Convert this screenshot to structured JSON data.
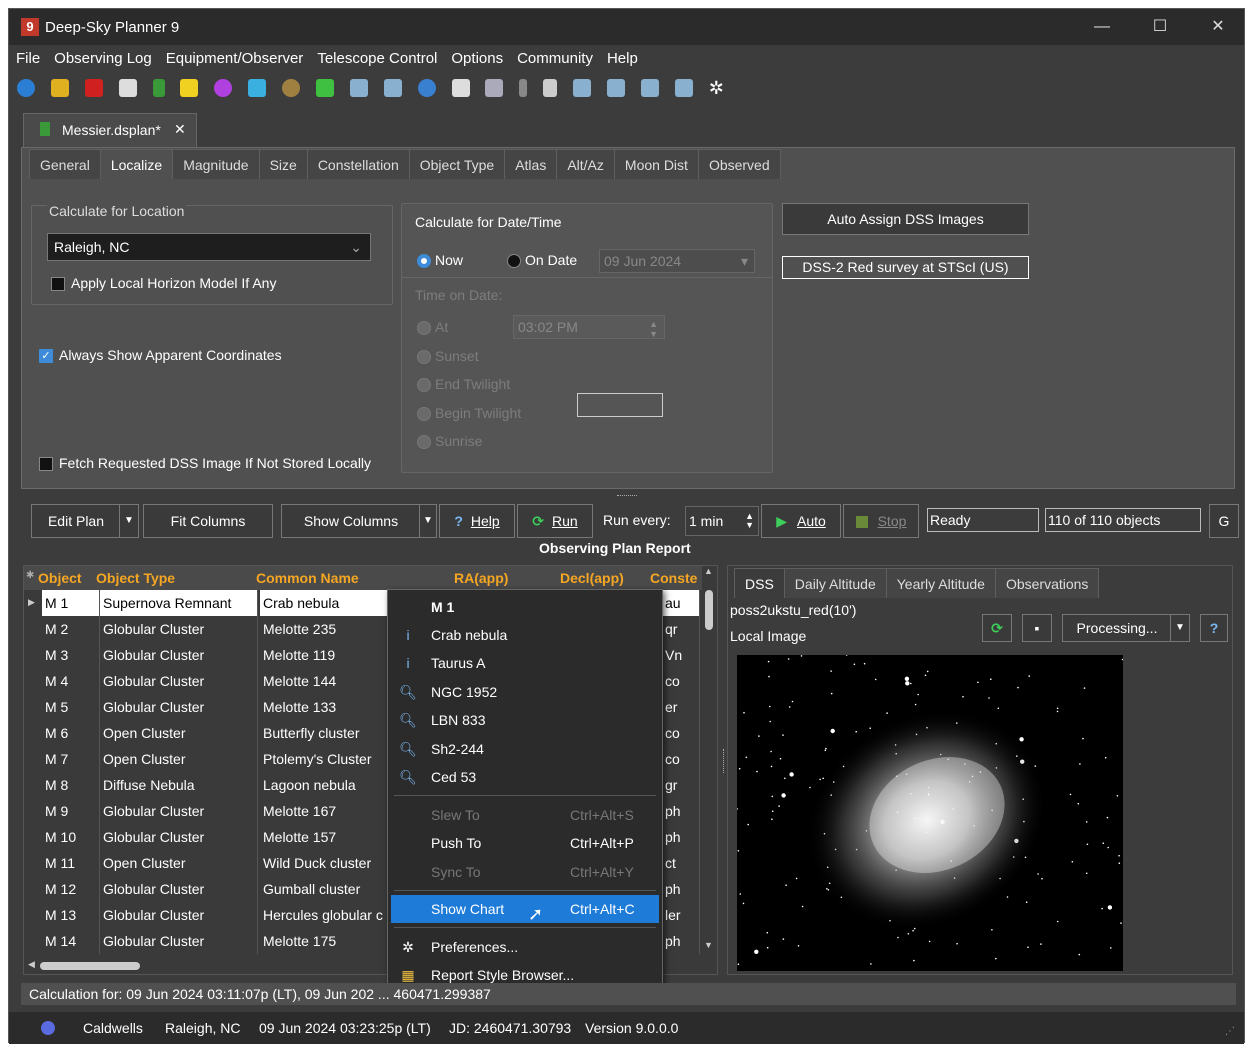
{
  "window": {
    "title": "Deep-Sky Planner 9",
    "app_icon": "9"
  },
  "menubar": [
    "File",
    "Observing Log",
    "Equipment/Observer",
    "Telescope Control",
    "Options",
    "Community",
    "Help"
  ],
  "document_tab": {
    "label": "Messier.dsplan*",
    "close": "✕"
  },
  "tabs": [
    "General",
    "Localize",
    "Magnitude",
    "Size",
    "Constellation",
    "Object Type",
    "Atlas",
    "Alt/Az",
    "Moon Dist",
    "Observed"
  ],
  "active_tab": "Localize",
  "location": {
    "group_title": "Calculate for Location",
    "value": "Raleigh, NC",
    "horizon_label": "Apply Local Horizon Model If Any"
  },
  "apparent_coords_label": "Always Show Apparent Coordinates",
  "fetch_dss_label": "Fetch Requested DSS Image If Not Stored Locally",
  "datetime": {
    "group_title": "Calculate for Date/Time",
    "now_label": "Now",
    "on_date_label": "On Date",
    "date_value": "09 Jun 2024",
    "time_on_date_label": "Time on Date:",
    "at_label": "At",
    "time_value": "03:02 PM",
    "sunset": "Sunset",
    "end_twilight": "End Twilight",
    "begin_twilight": "Begin Twilight",
    "sunrise": "Sunrise"
  },
  "dss": {
    "auto_assign": "Auto Assign DSS Images",
    "survey": "DSS-2 Red survey at STScI (US)"
  },
  "controls": {
    "edit_plan": "Edit Plan",
    "fit_columns": "Fit Columns",
    "show_columns": "Show Columns",
    "help": "Help",
    "run": "Run",
    "run_every_label": "Run every:",
    "run_every_value": "1 min",
    "auto": "Auto",
    "stop": "Stop",
    "status": "Ready",
    "count": "110 of 110 objects",
    "extra": "G"
  },
  "report_title": "Observing Plan Report",
  "columns": [
    "Object",
    "Object Type",
    "Common Name",
    "RA(app)",
    "Decl(app)",
    "Conste"
  ],
  "rows": [
    {
      "obj": "M 1",
      "type": "Supernova Remnant",
      "name": "Crab nebula",
      "con": "au"
    },
    {
      "obj": "M 2",
      "type": "Globular Cluster",
      "name": "Melotte 235",
      "con": "qr"
    },
    {
      "obj": "M 3",
      "type": "Globular Cluster",
      "name": "Melotte 119",
      "con": "Vn"
    },
    {
      "obj": "M 4",
      "type": "Globular Cluster",
      "name": "Melotte 144",
      "con": "co"
    },
    {
      "obj": "M 5",
      "type": "Globular Cluster",
      "name": "Melotte 133",
      "con": "er"
    },
    {
      "obj": "M 6",
      "type": "Open Cluster",
      "name": "Butterfly cluster",
      "con": "co"
    },
    {
      "obj": "M 7",
      "type": "Open Cluster",
      "name": "Ptolemy's Cluster",
      "con": "co"
    },
    {
      "obj": "M 8",
      "type": "Diffuse Nebula",
      "name": "Lagoon nebula",
      "con": "gr"
    },
    {
      "obj": "M 9",
      "type": "Globular Cluster",
      "name": "Melotte 167",
      "con": "ph"
    },
    {
      "obj": "M 10",
      "type": "Globular Cluster",
      "name": "Melotte 157",
      "con": "ph"
    },
    {
      "obj": "M 11",
      "type": "Open Cluster",
      "name": "Wild Duck cluster",
      "con": "ct"
    },
    {
      "obj": "M 12",
      "type": "Globular Cluster",
      "name": "Gumball cluster",
      "con": "ph"
    },
    {
      "obj": "M 13",
      "type": "Globular Cluster",
      "name": "Hercules globular c",
      "con": "ler"
    },
    {
      "obj": "M 14",
      "type": "Globular Cluster",
      "name": "Melotte 175",
      "con": "ph"
    }
  ],
  "context_menu": {
    "header": "M 1",
    "ids": [
      {
        "icon": "info-icon",
        "label": "Crab nebula"
      },
      {
        "icon": "info-icon",
        "label": "Taurus A"
      },
      {
        "icon": "search-icon",
        "label": "NGC 1952"
      },
      {
        "icon": "search-icon",
        "label": "LBN 833"
      },
      {
        "icon": "search-icon",
        "label": "Sh2-244"
      },
      {
        "icon": "search-icon",
        "label": "Ced 53"
      }
    ],
    "slew": {
      "label": "Slew To",
      "shortcut": "Ctrl+Alt+S"
    },
    "push": {
      "label": "Push To",
      "shortcut": "Ctrl+Alt+P"
    },
    "sync": {
      "label": "Sync To",
      "shortcut": "Ctrl+Alt+Y"
    },
    "show_chart": {
      "label": "Show Chart",
      "shortcut": "Ctrl+Alt+C"
    },
    "preferences": "Preferences...",
    "report_style": "Report Style Browser..."
  },
  "right_panel": {
    "tabs": [
      "DSS",
      "Daily Altitude",
      "Yearly Altitude",
      "Observations"
    ],
    "image_name": "poss2ukstu_red(10')",
    "image_source": "Local Image",
    "processing": "Processing..."
  },
  "status_bar": "Calculation for: 09 Jun 2024 03:11:07p (LT), 09 Jun 202 ... 460471.299387",
  "footer": {
    "catalog": "Caldwells",
    "location": "Raleigh, NC",
    "datetime": "09 Jun 2024 03:23:25p (LT)",
    "jd": "JD: 2460471.30793",
    "version": "Version 9.0.0.0"
  }
}
